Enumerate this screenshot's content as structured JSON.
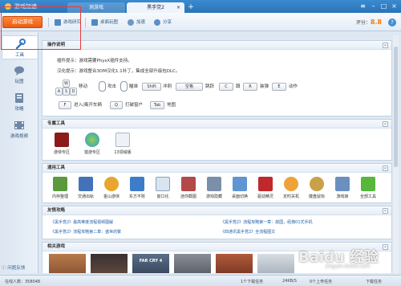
{
  "titlebar": {
    "logo": "游戏加速",
    "tabs": [
      "测游戏",
      "黑手党2"
    ],
    "add": "+"
  },
  "toolbar": {
    "start_button": "启动游戏",
    "tools": [
      "游戏研究",
      "桌面玩图",
      "加速",
      "分享"
    ],
    "score_label": "评分：",
    "score_value": "8.8",
    "help": "?"
  },
  "sidebar": {
    "items": [
      {
        "label": "工具",
        "icon": "wrench-icon"
      },
      {
        "label": "玩图",
        "icon": "chat-icon"
      },
      {
        "label": "攻略",
        "icon": "book-icon"
      },
      {
        "label": "游戏视频",
        "icon": "film-icon"
      }
    ],
    "feedback": "问题反馈"
  },
  "sections": {
    "ops": {
      "title": "操作说明",
      "lines": [
        "插件提示：游戏需要PhysX插件支持。",
        "汉化提示：游戏整合3DM汉化1.1补丁，集成全部升级包DLC。"
      ],
      "row1": {
        "keys": [
          "W",
          "A",
          "S",
          "D",
          "Shift",
          "空格",
          "C",
          "R",
          "E"
        ],
        "labels": [
          "移动",
          "攻击",
          "瞄准",
          "冲刺",
          "跳跃",
          "蹲",
          "装弹",
          "动作"
        ]
      },
      "row2": {
        "keys": [
          "F",
          "Q",
          "Tab"
        ],
        "labels": [
          "进入/离开车辆",
          "打破窗户",
          "地图"
        ]
      }
    },
    "special": {
      "title": "专属工具",
      "apps": [
        "游侠专区",
        "猎游专区",
        "13领域版"
      ]
    },
    "general": {
      "title": "通用工具",
      "apps": [
        "内存整理",
        "交通出轨",
        "金山游侠",
        "东方不败",
        "窗口化",
        "迷你截图",
        "游戏隐藏",
        "桌面切换",
        "驱动精灵",
        "定时关机",
        "键盘鼠标",
        "游戏锁",
        "全部工具"
      ]
    },
    "guides": {
      "title": "友情攻略",
      "links": [
        "《黑手党2》最高难度流程视频图解",
        "《黑手党2》流程攻略第一章：故国，经典01式手机",
        "《黑手党2》流程攻略第二章：盛世的繁",
        "《四通讯黑手党2》全流程图文"
      ]
    },
    "related": {
      "title": "相关游戏",
      "games": [
        "FAR CRY 4"
      ]
    }
  },
  "statusbar": {
    "users": "在线人数：358048",
    "download": "1个下载任务",
    "speed": "24KB/S",
    "upload": "0个上传任务",
    "manage": "下载任务"
  },
  "watermark": "Baidu 经验",
  "watermark_url": "jingyan.baidu.com",
  "colors": {
    "accent": "#2a73b8",
    "start": "#ec5b13",
    "score": "#ff7800",
    "highlight": "#ea3b3b"
  }
}
